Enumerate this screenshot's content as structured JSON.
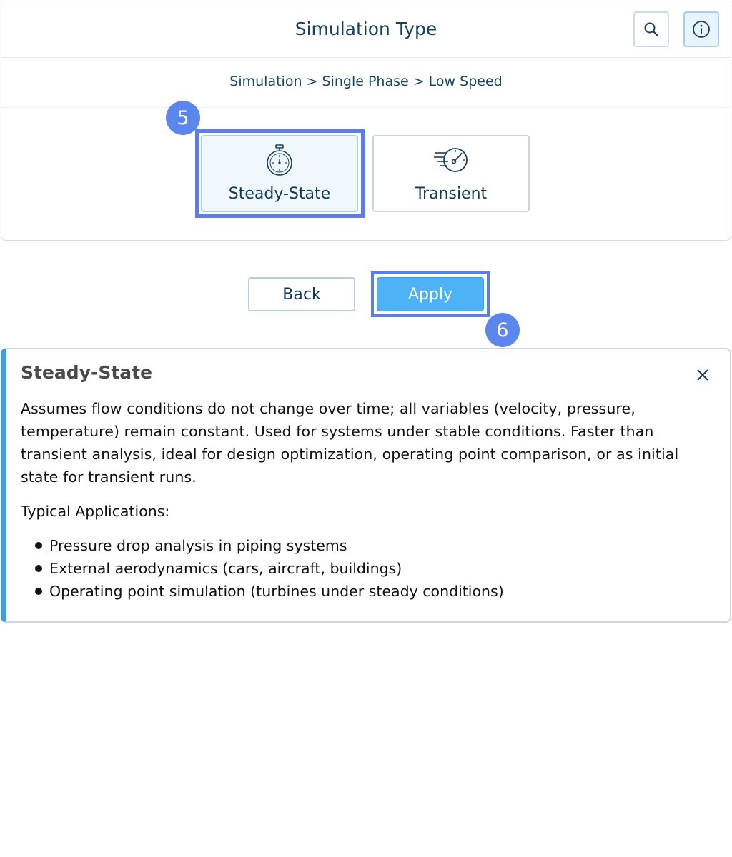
{
  "header": {
    "title": "Simulation Type",
    "search_icon": "search-icon",
    "info_icon": "info-icon"
  },
  "breadcrumb": "Simulation > Single Phase > Low Speed",
  "options": [
    {
      "label": "Steady-State",
      "icon": "stopwatch-icon",
      "selected": true
    },
    {
      "label": "Transient",
      "icon": "speed-gauge-icon",
      "selected": false
    }
  ],
  "step_badges": {
    "options": "5",
    "apply": "6"
  },
  "actions": {
    "back_label": "Back",
    "apply_label": "Apply"
  },
  "info_panel": {
    "title": "Steady-State",
    "description": "Assumes flow conditions do not change over time; all variables (velocity, pressure, temperature) remain constant. Used for systems under stable conditions. Faster than transient analysis, ideal for design optimization, operating point comparison, or as initial state for transient runs.",
    "applications_heading": "Typical Applications:",
    "applications": [
      "Pressure drop analysis in piping systems",
      "External aerodynamics (cars, aircraft, buildings)",
      "Operating point simulation (turbines under steady conditions)"
    ]
  },
  "colors": {
    "accent": "#4eb2f7",
    "highlight": "#5a7ef0",
    "badge": "#5b86ee",
    "info_border": "#3d9de0",
    "title_text": "#16405e"
  }
}
